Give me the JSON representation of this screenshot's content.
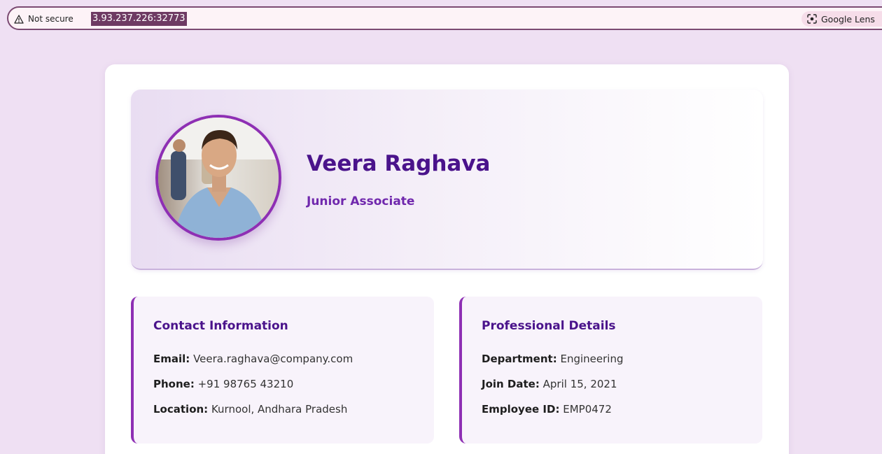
{
  "browser": {
    "security_label": "Not secure",
    "url": "3.93.237.226:32773",
    "lens_label": "Google Lens"
  },
  "profile": {
    "name": "Veera Raghava",
    "title": "Junior Associate"
  },
  "contact": {
    "heading": "Contact Information",
    "email_label": "Email:",
    "email": "Veera.raghava@company.com",
    "phone_label": "Phone:",
    "phone": "+91 98765 43210",
    "location_label": "Location:",
    "location": "Kurnool, Andhara Pradesh"
  },
  "professional": {
    "heading": "Professional Details",
    "department_label": "Department:",
    "department": "Engineering",
    "join_label": "Join Date:",
    "join_date": "April 15, 2021",
    "id_label": "Employee ID:",
    "employee_id": "EMP0472"
  },
  "colors": {
    "accent": "#8e2fb4",
    "heading": "#4a138b",
    "page_bg": "#efe0f3"
  },
  "icons": [
    "warning-icon",
    "google-lens-icon"
  ]
}
